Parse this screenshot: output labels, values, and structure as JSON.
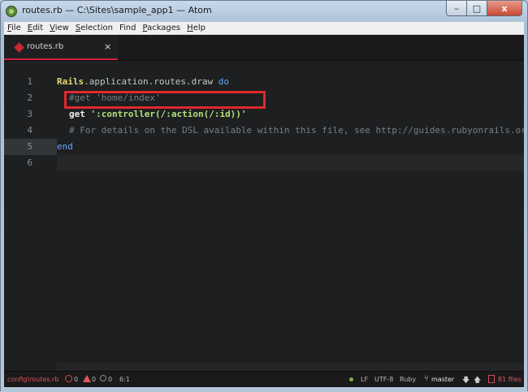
{
  "window": {
    "title": "routes.rb — C:\\Sites\\sample_app1 — Atom",
    "controls": {
      "minimize": "–",
      "maximize": "□",
      "close": "x"
    }
  },
  "menubar": {
    "items": [
      {
        "ul": "F",
        "rest": "ile"
      },
      {
        "ul": "E",
        "rest": "dit"
      },
      {
        "ul": "V",
        "rest": "iew"
      },
      {
        "ul": "S",
        "rest": "election"
      },
      {
        "ul": "F",
        "rest": "ind"
      },
      {
        "ul": "P",
        "rest": "ackages"
      },
      {
        "ul": "H",
        "rest": "elp"
      }
    ]
  },
  "tab": {
    "label": "routes.rb",
    "close": "×",
    "icon": "ruby-file-icon",
    "accent": "#d21f3c"
  },
  "editor": {
    "line_numbers": [
      "1",
      "2",
      "3",
      "4",
      "5",
      "6"
    ],
    "current_line": 6,
    "lines": {
      "l1": {
        "const": "Rails",
        "text": ".application.routes.draw ",
        "kw": "do"
      },
      "l2": {
        "comment": "#get 'home/index'"
      },
      "l3": {
        "method": "get ",
        "str": "':controller(/:action(/:id))'"
      },
      "l4": {
        "comment": "# For details on the DSL available within this file, see http://guides.rubyonrails.org/routing.html"
      },
      "l5": {
        "kw": "end"
      }
    },
    "highlight_color": "#e0282e"
  },
  "statusbar": {
    "path": "config\\routes.rb",
    "errors": "0",
    "warnings": "0",
    "infos": "0",
    "cursor": "6:1",
    "line_ending": "LF",
    "encoding": "UTF-8",
    "grammar": "Ruby",
    "branch": "master",
    "files": "81 files"
  }
}
